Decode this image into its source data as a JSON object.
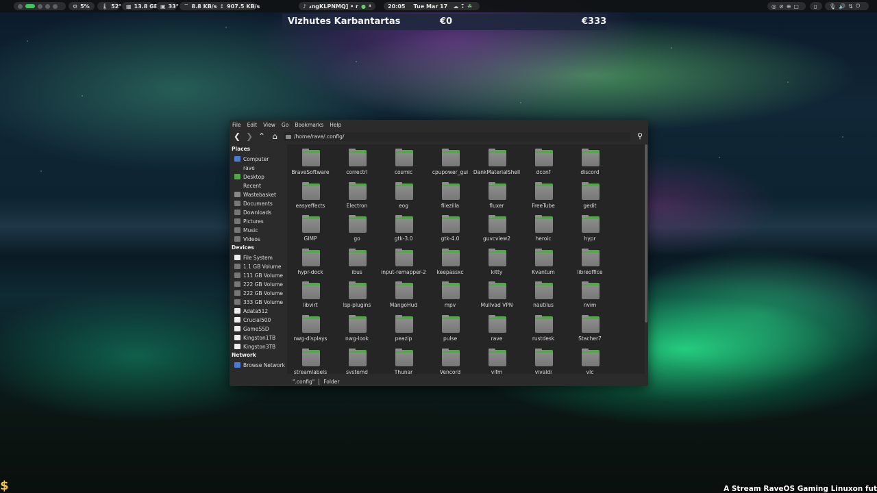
{
  "topbar": {
    "cpu": "5%",
    "temp1": "52°",
    "mem": "13.8 GB",
    "temp2": "33°",
    "down": "8.8 KB/s",
    "up": "907.5 KB/s",
    "media": "₄ngKLPNMQ] • r",
    "time": "20:05",
    "date": "Tue Mar 17",
    "weather": "7°C"
  },
  "widget": {
    "name": "Vizhutes Karbantartas",
    "value1": "€0",
    "value2": "€333"
  },
  "window": {
    "menu": [
      "File",
      "Edit",
      "View",
      "Go",
      "Bookmarks",
      "Help"
    ],
    "path": "/home/rave/.config/",
    "sidebar": {
      "places_title": "Places",
      "places": [
        "Computer",
        "rave",
        "Desktop",
        "Recent",
        "Wastebasket",
        "Documents",
        "Downloads",
        "Pictures",
        "Music",
        "Videos"
      ],
      "devices_title": "Devices",
      "devices": [
        "File System",
        "1.1 GB Volume",
        "111 GB Volume",
        "222 GB Volume",
        "222 GB Volume",
        "333 GB Volume",
        "Adata512",
        "Crucial500",
        "GameSSD",
        "Kingston1TB",
        "Kingston3TB"
      ],
      "network_title": "Network",
      "network": [
        "Browse Network"
      ]
    },
    "folders": [
      "BraveSoftware",
      "correctrl",
      "cosmic",
      "cpupower_gui",
      "DankMaterialShell",
      "dconf",
      "discord",
      "easyeffects",
      "Electron",
      "eog",
      "filezilla",
      "fluxer",
      "FreeTube",
      "gedit",
      "GIMP",
      "go",
      "gtk-3.0",
      "gtk-4.0",
      "guvcview2",
      "heroic",
      "hypr",
      "hypr-dock",
      "ibus",
      "input-remapper-2",
      "keepassxc",
      "kitty",
      "Kvantum",
      "libreoffice",
      "libvirt",
      "lsp-plugins",
      "MangoHud",
      "mpv",
      "Mullvad VPN",
      "nautilus",
      "nvim",
      "nwg-displays",
      "nwg-look",
      "peazip",
      "pulse",
      "rave",
      "rustdesk",
      "Stacher7",
      "streamlabels",
      "systemd",
      "Thunar",
      "Vencord",
      "vifm",
      "vivaldi",
      "vlc"
    ],
    "status_selected": "\".config\"",
    "status_type": "Folder"
  },
  "overlay_text": "A Stream RaveOS Gaming Linuxon fut",
  "colors": {
    "accent_green": "#3cc85a",
    "folder_gray": "#8c8c8c",
    "folder_tab": "#4faa45"
  }
}
